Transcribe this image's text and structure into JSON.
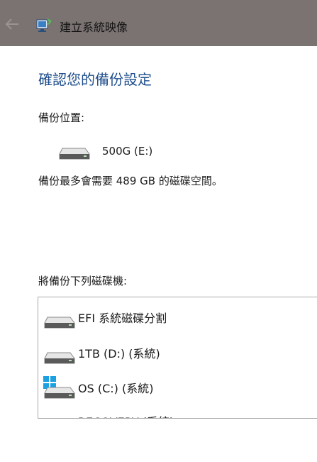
{
  "window": {
    "title": "建立系統映像",
    "back_icon": "back-arrow-icon",
    "app_icon": "backup-restore-icon"
  },
  "page": {
    "heading": "確認您的備份設定",
    "backup_location_label": "備份位置:",
    "backup_target": {
      "name": "500G (E:)",
      "icon": "hard-drive-icon"
    },
    "space_required": "備份最多會需要 489 GB 的磁碟空間。",
    "drives_list_label": "將備份下列磁碟機:",
    "drives": [
      {
        "label": "EFI 系統磁碟分割",
        "icon": "hard-drive-icon"
      },
      {
        "label": "1TB (D:) (系統)",
        "icon": "hard-drive-icon"
      },
      {
        "label": "OS (C:) (系統)",
        "icon": "windows-drive-icon"
      },
      {
        "label": "RECOVERY (系統)",
        "icon": "hard-drive-icon"
      }
    ]
  },
  "colors": {
    "titlebar": "#7a7371",
    "heading": "#1f4e8c",
    "windows_logo": "#1ba1e2"
  }
}
